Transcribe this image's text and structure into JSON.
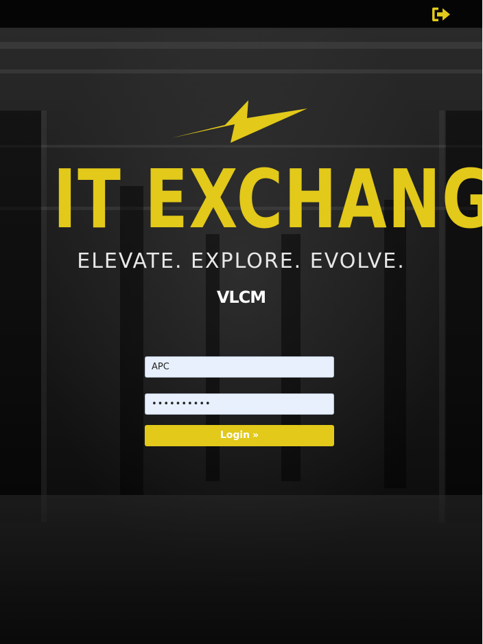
{
  "header": {
    "logout_icon": "sign-out-icon"
  },
  "branding": {
    "bolt_icon": "lightning-bolt-icon",
    "title": "IT EXCHANGE",
    "tagline": "ELEVATE. EXPLORE. EVOLVE.",
    "company": "VLCM"
  },
  "form": {
    "username_value": "APC",
    "password_value": "••••••••••",
    "login_label": "Login",
    "login_icon": "double-chevron-right-icon"
  },
  "colors": {
    "accent": "#e2c91a",
    "input_bg": "#e8f0fe",
    "topbar": "#050505"
  }
}
